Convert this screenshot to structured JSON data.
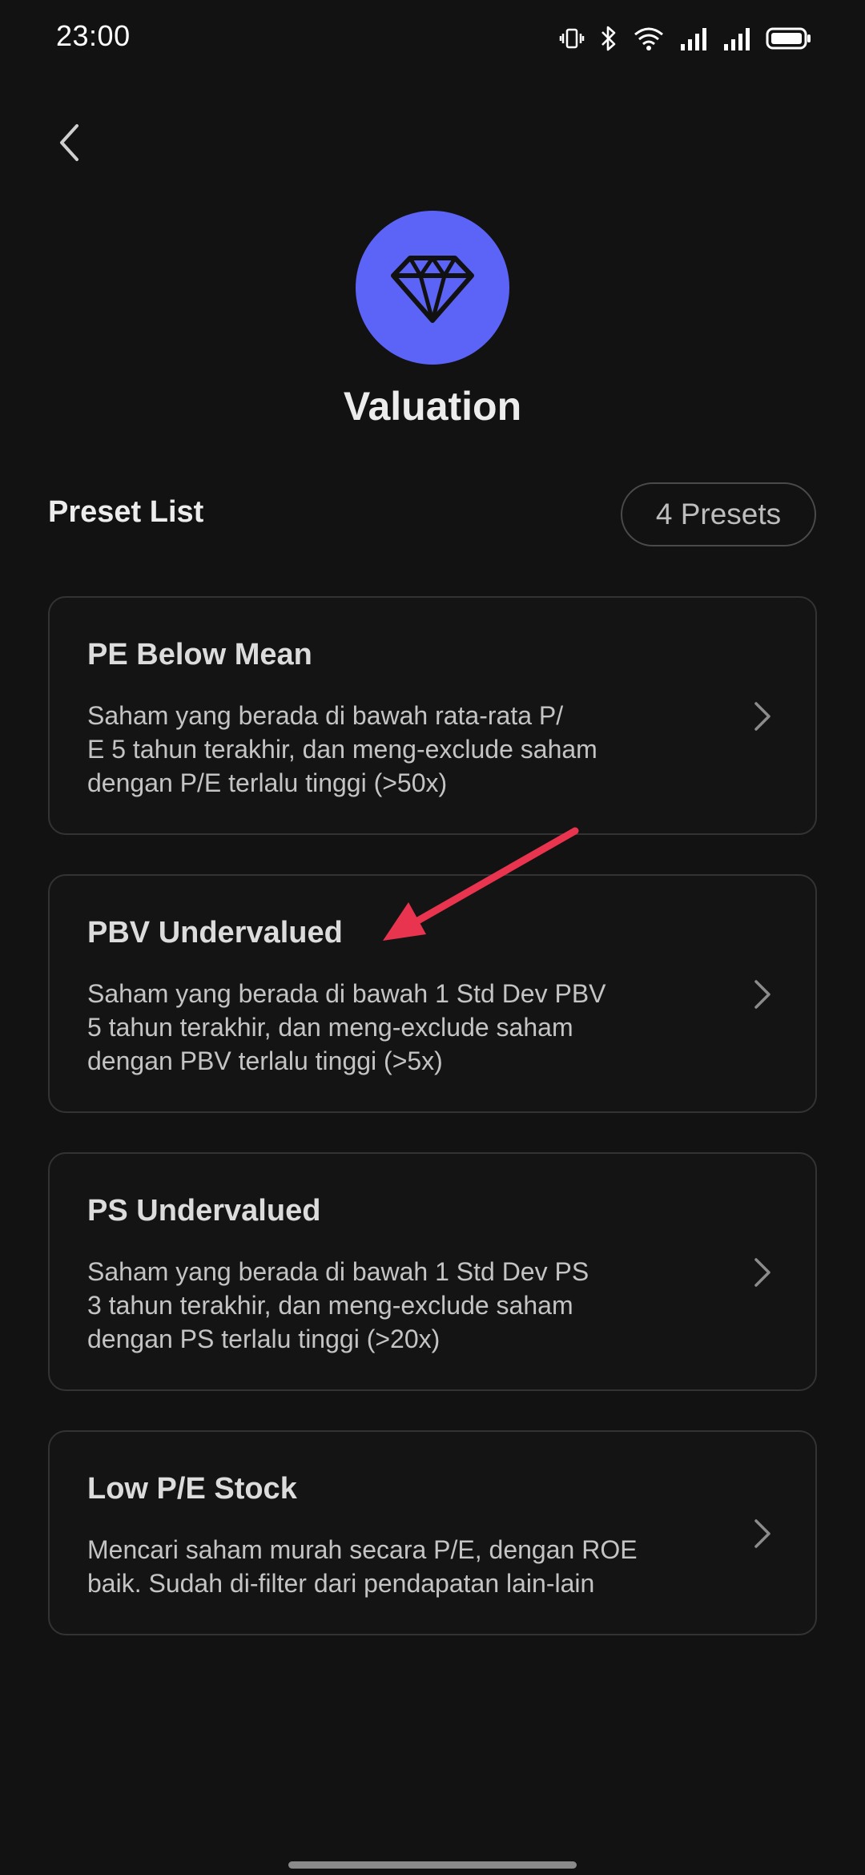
{
  "status_bar": {
    "time": "23:00",
    "icons": [
      "vibrate-icon",
      "bluetooth-icon",
      "wifi-icon",
      "signal-icon",
      "signal-icon",
      "battery-icon"
    ]
  },
  "header": {
    "back_icon": "chevron-left-icon",
    "category_icon": "diamond-icon",
    "category_icon_bg": "#5c63f7",
    "title": "Valuation"
  },
  "preset_list": {
    "label": "Preset List",
    "count_label": "4 Presets",
    "items": [
      {
        "title": "PE Below Mean",
        "description": "Saham yang berada di bawah rata-rata P/\nE 5 tahun terakhir, dan meng-exclude saham\ndengan P/E terlalu tinggi (>50x)"
      },
      {
        "title": "PBV Undervalued",
        "description": "Saham yang berada di bawah 1 Std Dev PBV\n5 tahun terakhir, dan meng-exclude saham\ndengan PBV terlalu tinggi (>5x)"
      },
      {
        "title": "PS Undervalued",
        "description": "Saham yang berada di bawah 1 Std Dev PS\n3 tahun terakhir, dan meng-exclude saham\ndengan PS terlalu tinggi (>20x)"
      },
      {
        "title": "Low P/E Stock",
        "description": "Mencari saham murah secara P/E, dengan ROE\nbaik. Sudah di-filter dari pendapatan lain-lain"
      }
    ]
  },
  "annotation": {
    "arrow_color": "#e8344e"
  }
}
